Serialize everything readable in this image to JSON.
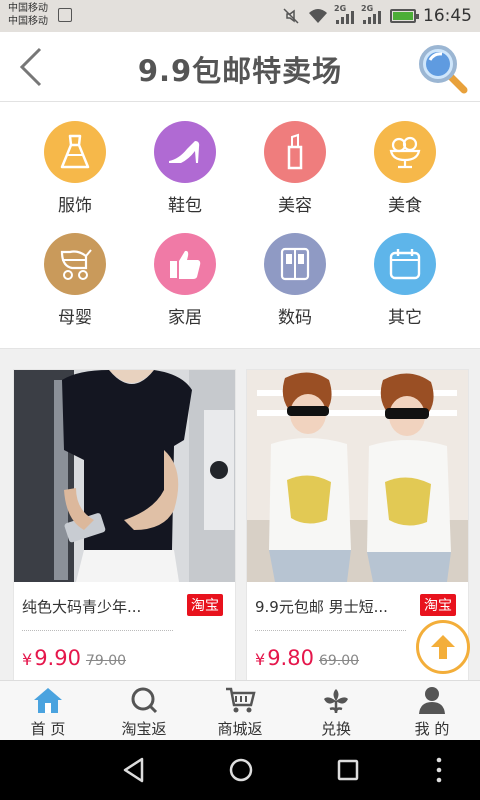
{
  "status_bar": {
    "carrier_1": "中国移动",
    "carrier_2": "中国移动",
    "signal_1_label": "2G",
    "signal_2_label": "2G",
    "time": "16:45"
  },
  "header": {
    "title": "9.9包邮特卖场",
    "back_icon": "back-arrow-icon",
    "search_icon": "magnifier-icon"
  },
  "categories": [
    {
      "label": "服饰",
      "icon": "dress-icon",
      "color": "#f6b84a"
    },
    {
      "label": "鞋包",
      "icon": "high-heel-icon",
      "color": "#b06ad3"
    },
    {
      "label": "美容",
      "icon": "lipstick-icon",
      "color": "#ef7d7d"
    },
    {
      "label": "美食",
      "icon": "ice-cream-icon",
      "color": "#f6b84a"
    },
    {
      "label": "母婴",
      "icon": "stroller-icon",
      "color": "#c99a5b"
    },
    {
      "label": "家居",
      "icon": "thumbs-up-icon",
      "color": "#f07aa6"
    },
    {
      "label": "数码",
      "icon": "device-icon",
      "color": "#8f9ac4"
    },
    {
      "label": "其它",
      "icon": "calendar-icon",
      "color": "#5eb5ea"
    }
  ],
  "products": [
    {
      "name": "纯色大码青少年...",
      "tag": "淘宝",
      "currency": "¥",
      "price": "9.90",
      "old_price": "79.00"
    },
    {
      "name": "9.9元包邮 男士短...",
      "tag": "淘宝",
      "currency": "¥",
      "price": "9.80",
      "old_price": "69.00"
    }
  ],
  "tabs": [
    {
      "label": "首 页",
      "icon": "home-icon",
      "active": true
    },
    {
      "label": "淘宝返",
      "icon": "taobao-search-icon"
    },
    {
      "label": "商城返",
      "icon": "cart-icon"
    },
    {
      "label": "兑换",
      "icon": "flower-icon"
    },
    {
      "label": "我 的",
      "icon": "user-icon"
    }
  ],
  "colors": {
    "accent_price": "#e5164b",
    "tag_red": "#e8121d",
    "scroll_top": "#f3ae3a",
    "home_active": "#4aa3df"
  }
}
